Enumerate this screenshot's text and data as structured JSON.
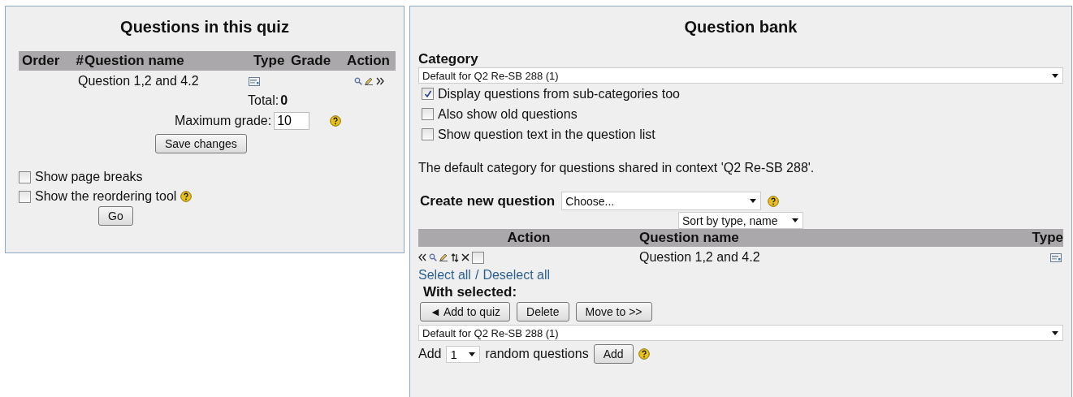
{
  "quiz_panel": {
    "title": "Questions in this quiz",
    "columns": [
      "Order",
      "#",
      "Question name",
      "Type",
      "Grade",
      "Action"
    ],
    "rows": [
      {
        "question_name": "Question 1,2 and 4.2"
      }
    ],
    "total_label": "Total:",
    "total_value": "0",
    "max_grade_label": "Maximum grade:",
    "max_grade_value": "10",
    "save_button": "Save changes",
    "options": [
      {
        "label": "Show page breaks",
        "checked": false,
        "help": false
      },
      {
        "label": "Show the reordering tool",
        "checked": false,
        "help": true
      }
    ],
    "go_button": "Go"
  },
  "bank_panel": {
    "title": "Question bank",
    "category_label": "Category",
    "category_value": "Default for Q2 Re-SB 288 (1)",
    "options": [
      {
        "label": "Display questions from sub-categories too",
        "checked": true
      },
      {
        "label": "Also show old questions",
        "checked": false
      },
      {
        "label": "Show question text in the question list",
        "checked": false
      }
    ],
    "category_info": "The default category for questions shared in context 'Q2 Re-SB 288'.",
    "create_label": "Create new question",
    "create_value": "Choose...",
    "sort_value": "Sort by type, name",
    "columns": [
      "Action",
      "Question name",
      "Type"
    ],
    "rows": [
      {
        "question_name": "Question 1,2 and 4.2",
        "checked": false
      }
    ],
    "select_all": "Select all",
    "separator": "/",
    "deselect_all": "Deselect all",
    "with_selected": "With selected:",
    "buttons": [
      "◄ Add to quiz",
      "Delete",
      "Move to >>"
    ],
    "move_category": "Default for Q2 Re-SB 288 (1)",
    "add_label": "Add",
    "add_count": "1",
    "random_label": "random questions",
    "add_button": "Add"
  }
}
